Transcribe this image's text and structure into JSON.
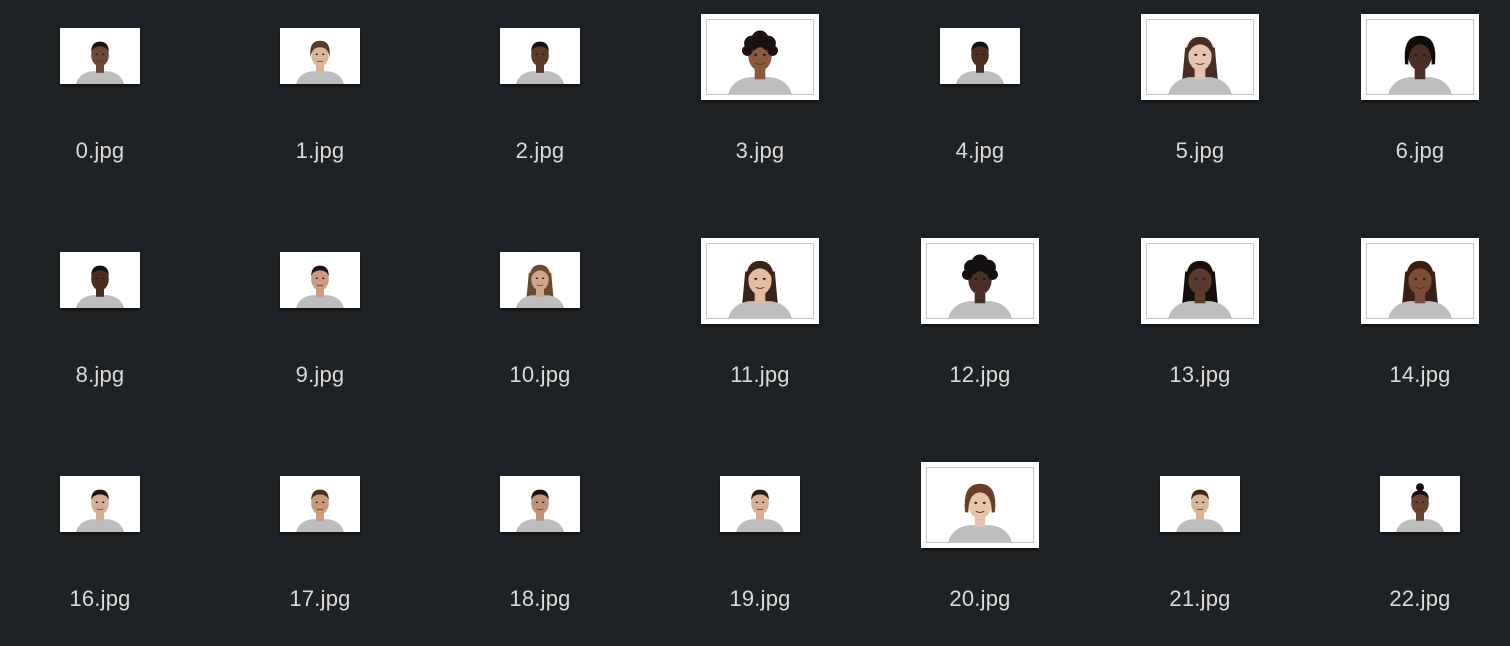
{
  "window": {
    "view": "icon-grid",
    "background": "#1f2224"
  },
  "files": [
    {
      "name": "0.jpg",
      "icon": "portrait-thumbnail-icon",
      "thumb_style": "small",
      "skin": "#6b4a35",
      "hair": "#1a1412",
      "hair_style": "short"
    },
    {
      "name": "1.jpg",
      "icon": "portrait-thumbnail-icon",
      "thumb_style": "small",
      "skin": "#d9b59c",
      "hair": "#5a3b26",
      "hair_style": "medium"
    },
    {
      "name": "2.jpg",
      "icon": "portrait-thumbnail-icon",
      "thumb_style": "small",
      "skin": "#5a3a28",
      "hair": "#161010",
      "hair_style": "short"
    },
    {
      "name": "3.jpg",
      "icon": "portrait-thumbnail-icon",
      "thumb_style": "large",
      "skin": "#8a5a3c",
      "hair": "#1a1210",
      "hair_style": "curly"
    },
    {
      "name": "4.jpg",
      "icon": "portrait-thumbnail-icon",
      "thumb_style": "small",
      "skin": "#4a3024",
      "hair": "#121010",
      "hair_style": "short"
    },
    {
      "name": "5.jpg",
      "icon": "portrait-thumbnail-icon",
      "thumb_style": "large",
      "skin": "#e4c4b0",
      "hair": "#4a2e22",
      "hair_style": "long"
    },
    {
      "name": "6.jpg",
      "icon": "portrait-thumbnail-icon",
      "thumb_style": "large",
      "skin": "#4a2e24",
      "hair": "#100c0c",
      "hair_style": "bob"
    },
    {
      "name": "8.jpg",
      "icon": "portrait-thumbnail-icon",
      "thumb_style": "small",
      "skin": "#4a2e22",
      "hair": "#121010",
      "hair_style": "short"
    },
    {
      "name": "9.jpg",
      "icon": "portrait-thumbnail-icon",
      "thumb_style": "small",
      "skin": "#c89a80",
      "hair": "#1e1612",
      "hair_style": "short"
    },
    {
      "name": "10.jpg",
      "icon": "portrait-thumbnail-icon",
      "thumb_style": "small",
      "skin": "#d2a48a",
      "hair": "#6a4a32",
      "hair_style": "long"
    },
    {
      "name": "11.jpg",
      "icon": "portrait-thumbnail-icon",
      "thumb_style": "large",
      "skin": "#e2bca4",
      "hair": "#3a2418",
      "hair_style": "long"
    },
    {
      "name": "12.jpg",
      "icon": "portrait-thumbnail-icon",
      "thumb_style": "large",
      "skin": "#4a3026",
      "hair": "#141010",
      "hair_style": "curly"
    },
    {
      "name": "13.jpg",
      "icon": "portrait-thumbnail-icon",
      "thumb_style": "large",
      "skin": "#5a3a2c",
      "hair": "#141010",
      "hair_style": "long"
    },
    {
      "name": "14.jpg",
      "icon": "portrait-thumbnail-icon",
      "thumb_style": "large",
      "skin": "#7a4e36",
      "hair": "#3a1e16",
      "hair_style": "long"
    },
    {
      "name": "16.jpg",
      "icon": "portrait-thumbnail-icon",
      "thumb_style": "small",
      "skin": "#d6ae94",
      "hair": "#1e1612",
      "hair_style": "short"
    },
    {
      "name": "17.jpg",
      "icon": "portrait-thumbnail-icon",
      "thumb_style": "small",
      "skin": "#c89a7c",
      "hair": "#4a3222",
      "hair_style": "short"
    },
    {
      "name": "18.jpg",
      "icon": "portrait-thumbnail-icon",
      "thumb_style": "small",
      "skin": "#c09278",
      "hair": "#1a1410",
      "hair_style": "short"
    },
    {
      "name": "19.jpg",
      "icon": "portrait-thumbnail-icon",
      "thumb_style": "small",
      "skin": "#d8b096",
      "hair": "#2a1e16",
      "hair_style": "short"
    },
    {
      "name": "20.jpg",
      "icon": "portrait-thumbnail-icon",
      "thumb_style": "large",
      "skin": "#e6c4ac",
      "hair": "#6a3e24",
      "hair_style": "bob"
    },
    {
      "name": "21.jpg",
      "icon": "portrait-thumbnail-icon",
      "thumb_style": "small",
      "skin": "#dcb49a",
      "hair": "#3a281c",
      "hair_style": "short"
    },
    {
      "name": "22.jpg",
      "icon": "portrait-thumbnail-icon",
      "thumb_style": "small",
      "skin": "#6a4230",
      "hair": "#141010",
      "hair_style": "bun"
    }
  ]
}
